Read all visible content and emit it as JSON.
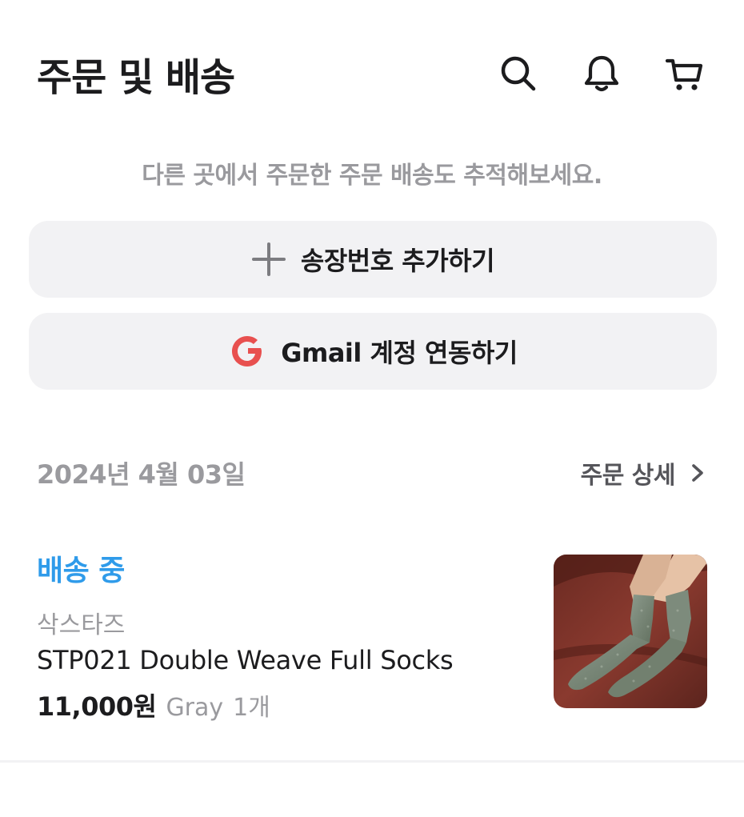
{
  "header": {
    "title": "주문 및 배송",
    "icons": [
      "search-icon",
      "bell-icon",
      "cart-icon"
    ]
  },
  "tip": "다른 곳에서 주문한 주문 배송도 추적해보세요.",
  "actions": {
    "add_tracking_label": "송장번호 추가하기",
    "gmail_link_label": "Gmail 계정 연동하기"
  },
  "order": {
    "date": "2024년 4월 03일",
    "detail_label": "주문 상세",
    "status": "배송 중",
    "brand": "삭스타즈",
    "product_name": "STP021 Double Weave Full Socks",
    "price": "11,000원",
    "option_color": "Gray",
    "quantity": "1개"
  },
  "colors": {
    "status": "#2f9bea",
    "google_g": "#e8504f",
    "button_bg": "#f2f2f4",
    "muted_text": "#9a9a9e"
  }
}
